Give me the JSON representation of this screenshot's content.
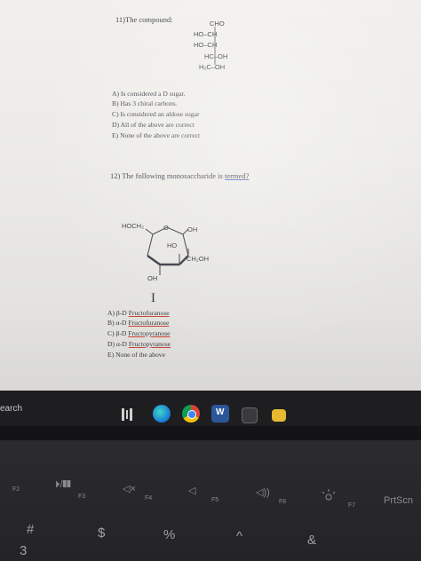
{
  "q11": {
    "title": "11)The compound:",
    "fischer": [
      "CHO",
      "HO–CH",
      "HO–CH",
      "HC–OH",
      "H₂C–OH"
    ],
    "options": [
      "A)  Is considered a D sugar.",
      "B)  Has 3 chiral carbons.",
      "C)  Is considered an aldose sugar",
      "D)  All of the above are correct",
      "E)  None of the above are correct"
    ]
  },
  "q12": {
    "title_prefix": "12) The following monosaccharide is",
    "title_underlined": "termed?",
    "ring_labels": {
      "hoch2": "HOCH₂",
      "o": "O",
      "oh_top": "OH",
      "ho": "HO",
      "ch2oh": "CH₂OH",
      "oh_bottom": "OH"
    },
    "roman": "I",
    "options": [
      {
        "prefix": "A)  β-D ",
        "term": "Fructofuranose"
      },
      {
        "prefix": "B)  α-D ",
        "term": "Fructofuranose"
      },
      {
        "prefix": "C)  β-D ",
        "term": "Fructopyranose"
      },
      {
        "prefix": "D)  α-D ",
        "term": "Fructopyranose"
      },
      {
        "prefix": "E)  None of the above",
        "term": ""
      }
    ]
  },
  "taskbar": {
    "search_text": "earch",
    "icons": [
      "task-view-icon",
      "edge-icon",
      "chrome-icon",
      "word-icon",
      "store-icon",
      "files-icon"
    ]
  },
  "keyboard": {
    "f2": "F2",
    "f3": "F3",
    "f4": "F4",
    "f5": "F5",
    "f6": "F6",
    "f7": "F7",
    "play_pause": "⏵/❚❚",
    "mute": "◁×",
    "vol_down": "◁",
    "vol_up": "◁))",
    "prtscn": "PrtScn",
    "hash": "#",
    "dollar": "$",
    "percent": "%",
    "caret": "^",
    "ampersand": "&",
    "three": "3"
  }
}
